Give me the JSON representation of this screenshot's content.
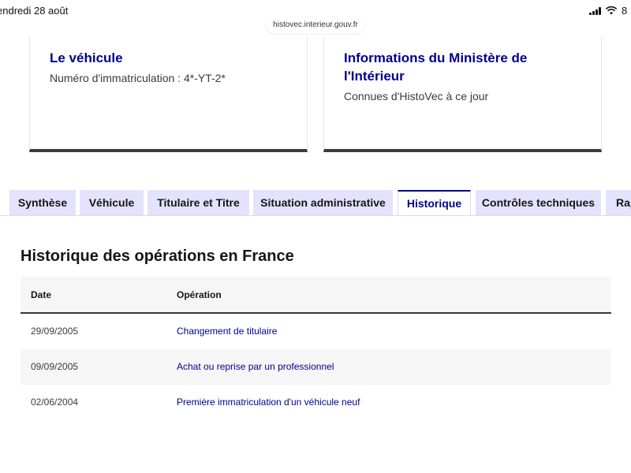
{
  "status_bar": {
    "time": "endredi 28 août",
    "battery": "8"
  },
  "browser": {
    "url": "histovec.interieur.gouv.fr"
  },
  "cards": [
    {
      "title": "Le véhicule",
      "description": "Numéro d'immatriculation : 4*-YT-2*"
    },
    {
      "title": "Informations du Ministère de l'Intérieur",
      "description": "Connues d'HistoVec à ce jour"
    }
  ],
  "tabs": [
    {
      "label": "Synthèse"
    },
    {
      "label": "Véhicule"
    },
    {
      "label": "Titulaire et Titre"
    },
    {
      "label": "Situation administrative"
    },
    {
      "label": "Historique",
      "active": true
    },
    {
      "label": "Contrôles techniques"
    },
    {
      "label": "Rap"
    }
  ],
  "history": {
    "title": "Historique des opérations en France",
    "columns": [
      "Date",
      "Opération"
    ],
    "rows": [
      {
        "date": "29/09/2005",
        "operation": "Changement de titulaire"
      },
      {
        "date": "09/09/2005",
        "operation": "Achat ou reprise par un professionnel"
      },
      {
        "date": "02/06/2004",
        "operation": "Première immatriculation d'un véhicule neuf"
      }
    ]
  },
  "colors": {
    "accent": "#000091",
    "tab_bg": "#e3e3fd",
    "row_alt": "#f6f6f6"
  }
}
